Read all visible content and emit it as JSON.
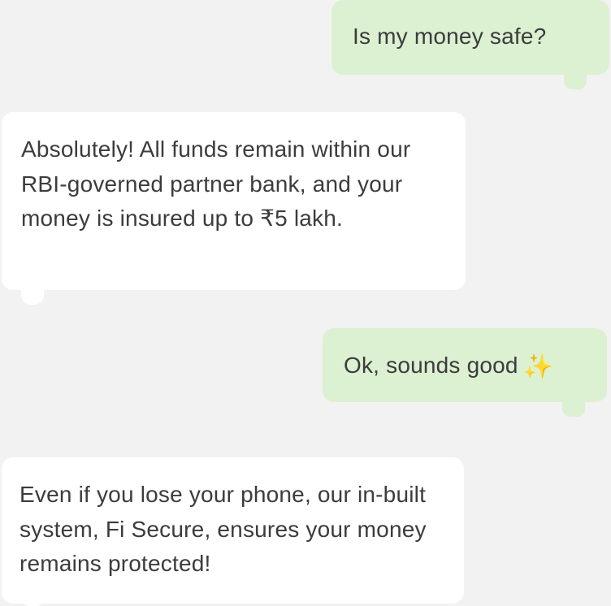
{
  "chat": {
    "messages": [
      {
        "sender": "user",
        "text": "Is my money safe?"
      },
      {
        "sender": "bot",
        "text": "Absolutely! All funds remain within our RBI-governed partner bank, and your money is insured up to ₹5 lakh."
      },
      {
        "sender": "user",
        "text": "Ok, sounds good",
        "emoji": "sparkles",
        "emoji_glyph": "✨"
      },
      {
        "sender": "bot",
        "text": "Even if you lose your phone, our in-built system, Fi Secure, ensures your money remains protected!"
      }
    ]
  },
  "colors": {
    "background": "#f2f2f2",
    "sent_bubble": "#dcf0d2",
    "received_bubble": "#ffffff",
    "text": "#3c3c3c"
  }
}
